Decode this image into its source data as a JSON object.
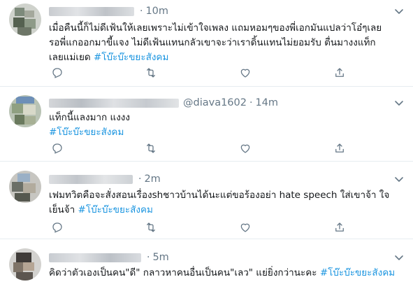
{
  "tweets": [
    {
      "handle": "",
      "time": "10m",
      "lines": [
        {
          "text": "เมื่อคืนนี้ก็ไม่ดีเฟ้นให้เลยเพราะไม่เข้าใจเพลง แถมหอมๆของพี่เอกมันแปลว่าโอ๋ๆเลย",
          "tag": ""
        },
        {
          "text": "รอพี่แกออกมาขี้แจง ไม่ดีเฟ้นแทนกลัวเขาจะว่าเราดิ้นแทนไม่ยอมรับ ตื่นมางงแท็ก",
          "tag": ""
        },
        {
          "text": "เลยแม่เยด ",
          "tag": "#โบ๊ะบ๊ะขยะสังคม"
        }
      ]
    },
    {
      "handle": "@diava1602",
      "time": "14m",
      "lines": [
        {
          "text": "แท็กนี้แลงมาก แงงง",
          "tag": ""
        },
        {
          "text": "",
          "tag": "#โบ๊ะบ๊ะขยะสังคม"
        }
      ]
    },
    {
      "handle": "",
      "time": "2m",
      "lines": [
        {
          "text": "เฟมทวิตคือจะสั่งสอนเรื่องshชาวบ้านได้นะแต่ขอร้องอย่า hate speech ใส่เขาจ้า ใจ",
          "tag": ""
        },
        {
          "text": "เย็นจ้า ",
          "tag": "#โบ๊ะบ๊ะขยะสังคม"
        }
      ]
    },
    {
      "handle": "",
      "time": "5m",
      "lines": [
        {
          "text": "คิดว่าตัวเองเป็นคน\"ดี\" กลาวหาคนอื่นเป็นคน\"เลว\" แย่ยิ่งกว่านะคะ ",
          "tag": "#โบ๊ะบ๊ะขยะสังคม"
        }
      ]
    }
  ],
  "icons": {
    "reply": "reply-icon",
    "retweet": "retweet-icon",
    "like": "heart-icon",
    "share": "share-icon",
    "more": "chevron-down-icon"
  },
  "colors": {
    "hashtag": "#1b95e0",
    "meta": "#657786",
    "icon": "#657786",
    "divider": "#e6ecf0"
  }
}
